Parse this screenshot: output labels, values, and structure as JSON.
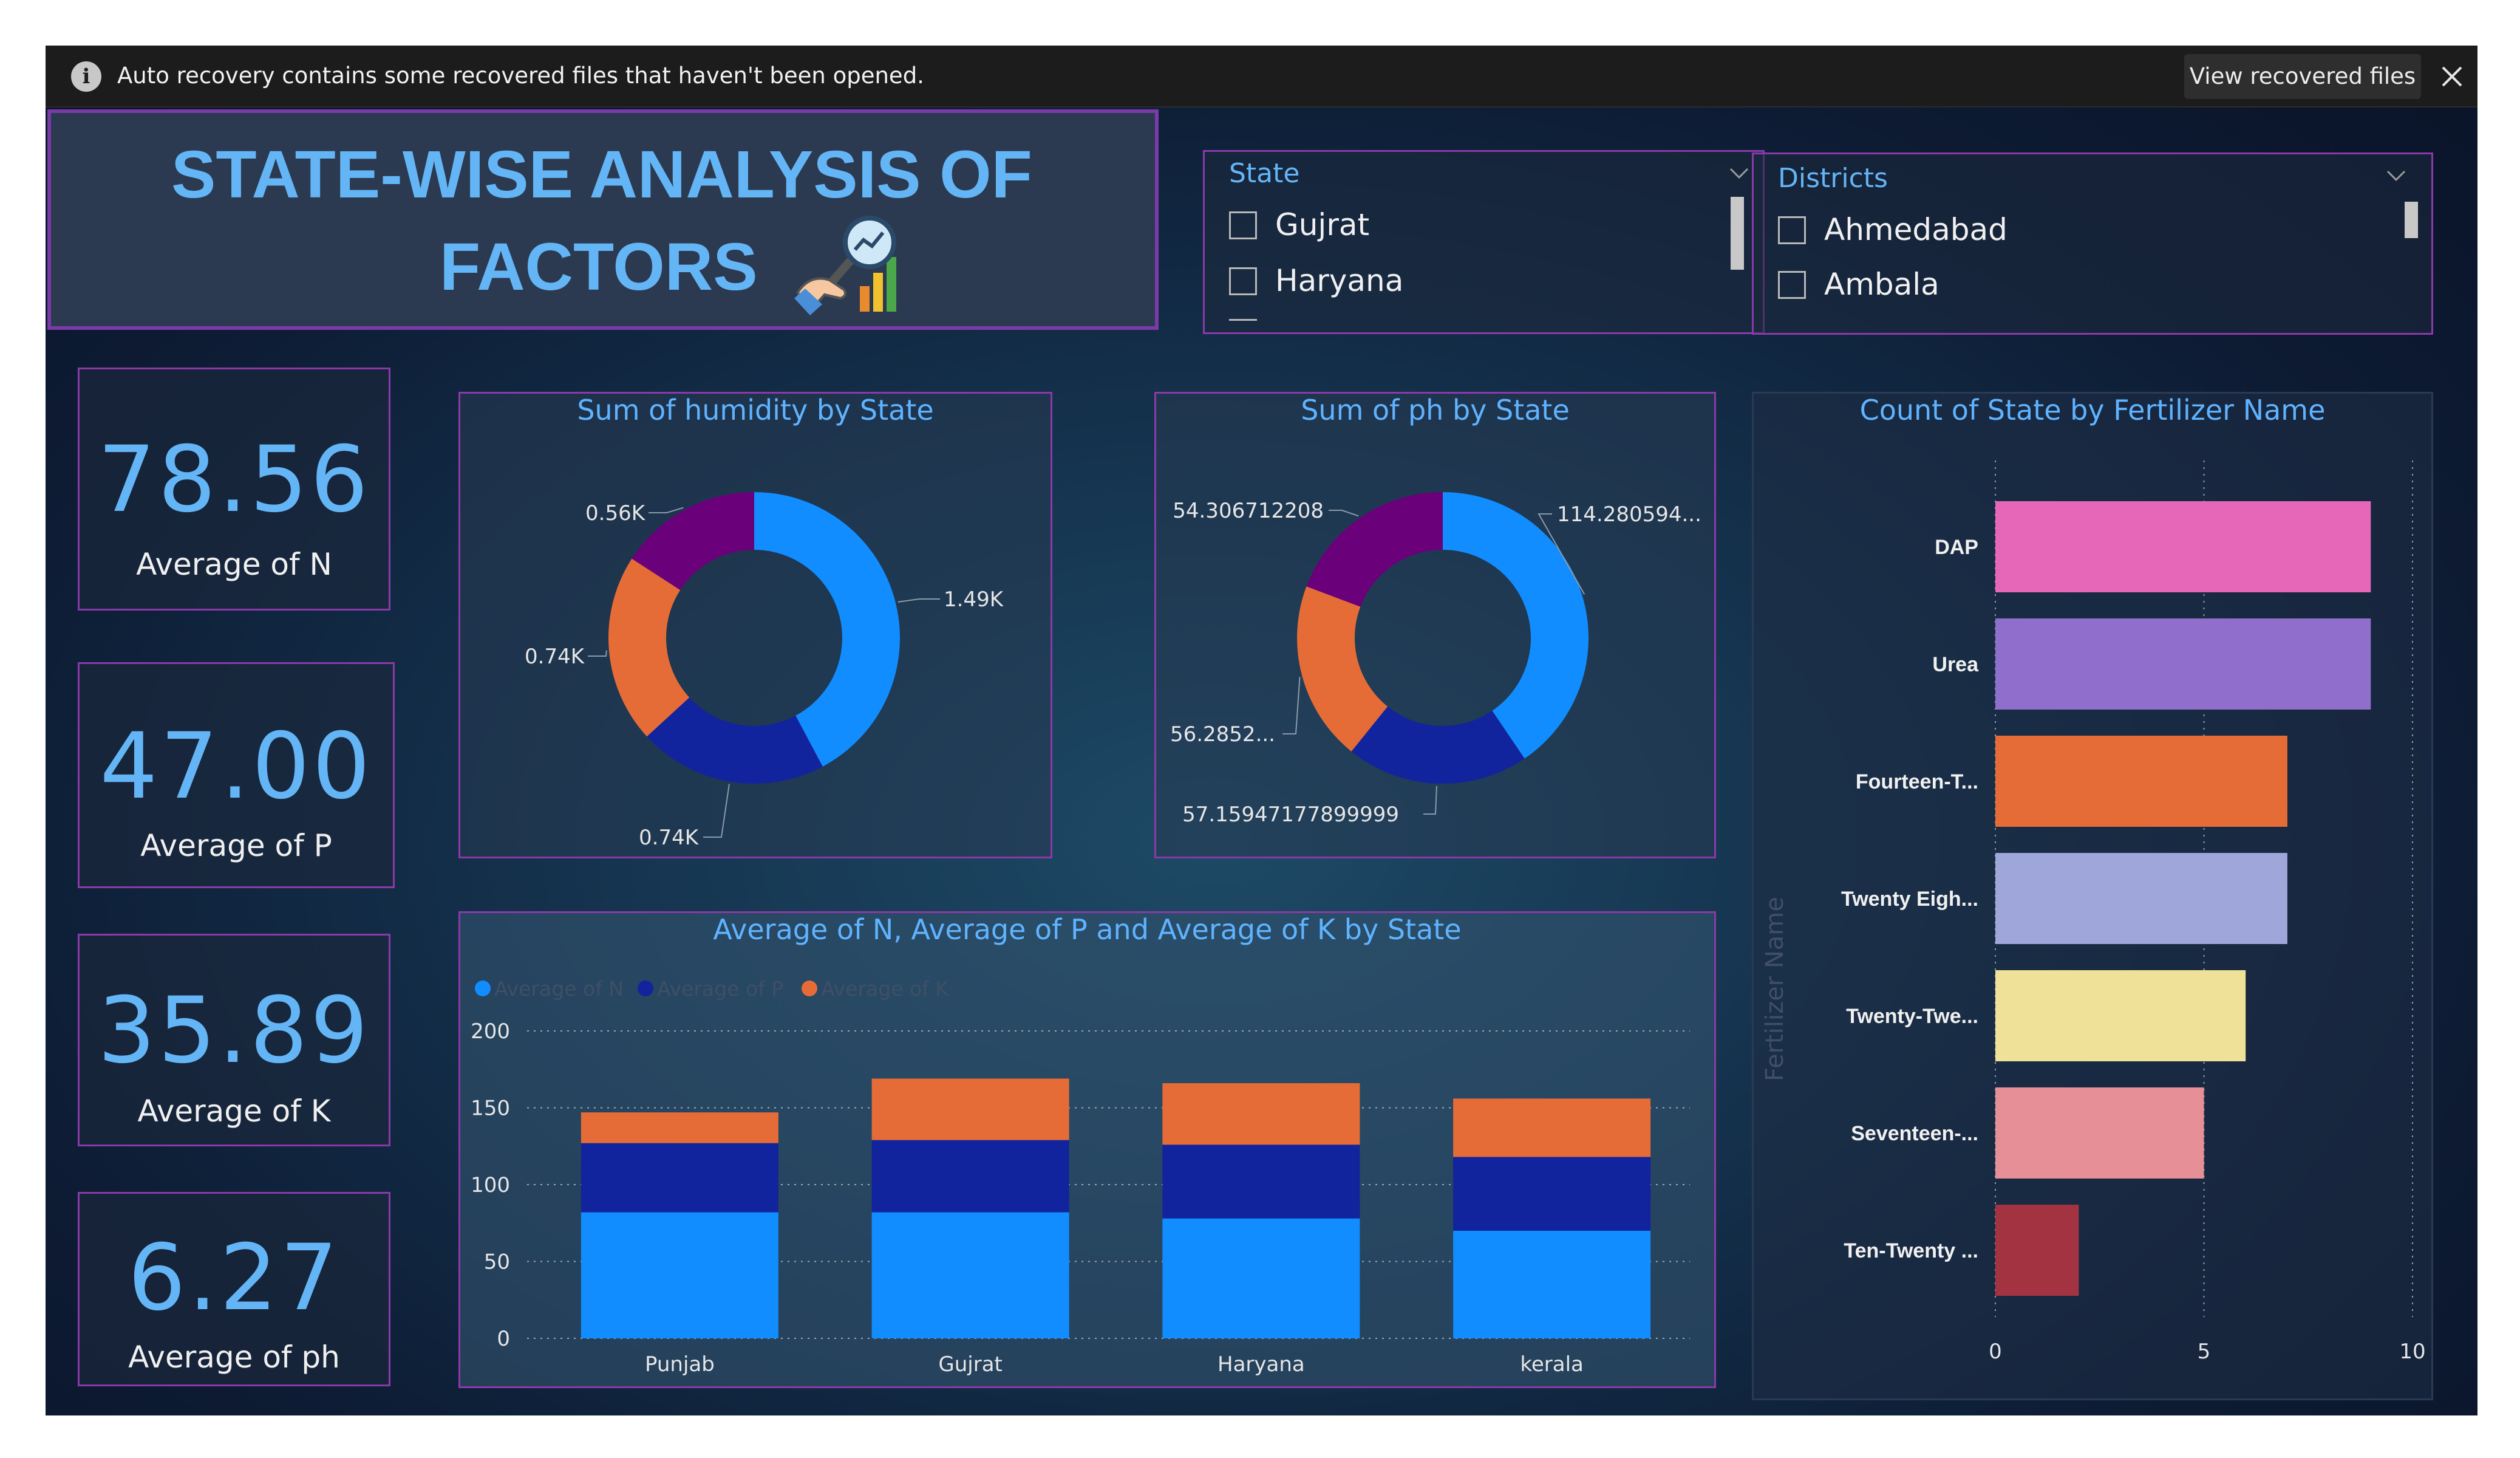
{
  "notification": {
    "message": "Auto recovery contains some recovered files that haven't been opened.",
    "view_button": "View recovered files"
  },
  "title": {
    "line1": "STATE-WISE ANALYSIS OF",
    "line2": "FACTORS"
  },
  "state_slicer": {
    "header": "State",
    "options": [
      "Gujrat",
      "Haryana"
    ]
  },
  "districts_slicer": {
    "header": "Districts",
    "options": [
      "Ahmedabad",
      "Ambala"
    ]
  },
  "kpis": [
    {
      "value": "78.56",
      "label": "Average of N"
    },
    {
      "value": "47.00",
      "label": "Average of P"
    },
    {
      "value": "35.89",
      "label": "Average of K"
    },
    {
      "value": "6.27",
      "label": "Average of ph"
    }
  ],
  "colors": {
    "blue": "#118dff",
    "navy": "#12239e",
    "orange": "#e66c37",
    "purple": "#6b007b",
    "accent_text": "#64b5f6",
    "border": "#8a3aa8"
  },
  "chart_data": [
    {
      "type": "pie",
      "title": "Sum of humidity by State",
      "labels": [
        "1.49K",
        "0.74K",
        "0.74K",
        "0.56K"
      ],
      "values": [
        1490,
        740,
        740,
        560
      ]
    },
    {
      "type": "pie",
      "title": "Sum of ph by State",
      "labels": [
        "114.280594...",
        "57.15947177899999",
        "56.2852...",
        "54.306712208"
      ],
      "values": [
        114.28,
        57.16,
        56.29,
        54.31
      ]
    },
    {
      "type": "bar",
      "stacked": true,
      "title": "Average of N, Average of P and Average of K by State",
      "categories": [
        "Punjab",
        "Gujrat",
        "Haryana",
        "kerala"
      ],
      "series": [
        {
          "name": "Average of N",
          "values": [
            82,
            82,
            78,
            70
          ]
        },
        {
          "name": "Average of P",
          "values": [
            45,
            47,
            48,
            48
          ]
        },
        {
          "name": "Average of K",
          "values": [
            20,
            40,
            40,
            38
          ]
        }
      ],
      "y_ticks": [
        "0",
        "50",
        "100",
        "150",
        "200"
      ],
      "ylim": [
        0,
        200
      ],
      "legend_position": "top-left",
      "grid": true
    },
    {
      "type": "bar",
      "orientation": "horizontal",
      "title": "Count of State by Fertilizer Name",
      "ylabel": "Fertilizer Name",
      "categories": [
        "DAP",
        "Urea",
        "Fourteen-T...",
        "Twenty Eigh...",
        "Twenty-Twe...",
        "Seventeen-...",
        "Ten-Twenty ..."
      ],
      "values": [
        9,
        9,
        7,
        7,
        6,
        5,
        2
      ],
      "x_ticks": [
        "0",
        "5",
        "10"
      ],
      "xlim": [
        0,
        10
      ],
      "bar_colors": [
        "#e667b8",
        "#8f6fcb",
        "#e66c37",
        "#9ea6da",
        "#f0e199",
        "#e68f96",
        "#a43342"
      ],
      "grid": true
    }
  ]
}
